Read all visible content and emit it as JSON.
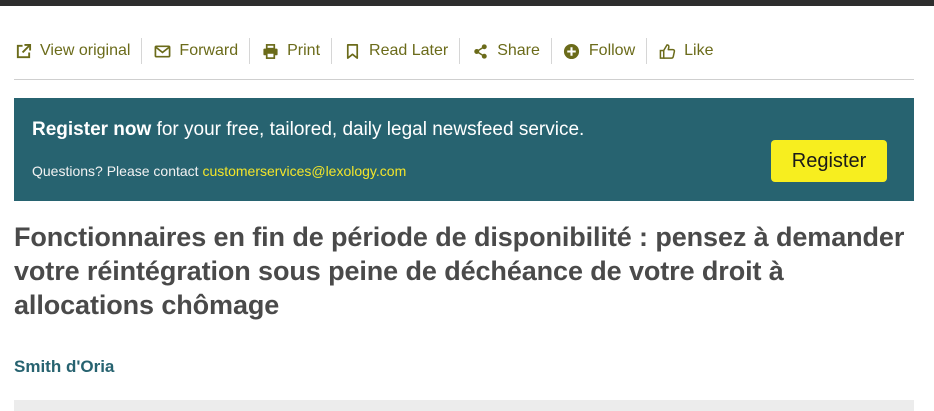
{
  "toolbar": {
    "items": [
      {
        "label": "View original",
        "icon": "external-link-icon"
      },
      {
        "label": "Forward",
        "icon": "envelope-icon"
      },
      {
        "label": "Print",
        "icon": "printer-icon"
      },
      {
        "label": "Read Later",
        "icon": "bookmark-icon"
      },
      {
        "label": "Share",
        "icon": "share-icon"
      },
      {
        "label": "Follow",
        "icon": "plus-circle-icon"
      },
      {
        "label": "Like",
        "icon": "thumbs-up-icon"
      }
    ],
    "color": "#6b6b1a"
  },
  "banner": {
    "title_bold": "Register now",
    "title_rest": " for your free, tailored, daily legal newsfeed service.",
    "questions_prefix": "Questions? Please contact ",
    "email": "customerservices@lexology.com",
    "register_label": "Register",
    "background_color": "#276370",
    "button_color": "#f7ee1f",
    "email_color": "#f3e52a"
  },
  "article": {
    "title": "Fonctionnaires en fin de période de disponibilité : pensez à demander votre réintégration sous peine de déchéance de votre droit à allocations chômage",
    "author": "Smith d'Oria"
  }
}
